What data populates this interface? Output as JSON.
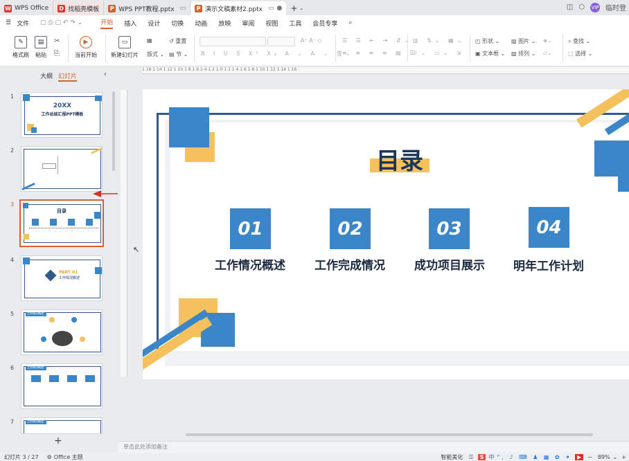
{
  "tabs": [
    {
      "label": "WPS Office",
      "icon": "W",
      "color": "#e0352b"
    },
    {
      "label": "找稻壳模板",
      "icon": "D",
      "color": "#e0352b"
    },
    {
      "label": "WPS PPT教程.pptx",
      "icon": "P",
      "color": "#d4622a"
    },
    {
      "label": "演示文稿素材2.pptx",
      "icon": "P",
      "color": "#d4622a"
    }
  ],
  "user": {
    "name": "临时登",
    "avatar": "VIP"
  },
  "menu": {
    "file": "文件",
    "items": [
      "开始",
      "插入",
      "设计",
      "切换",
      "动画",
      "放映",
      "审阅",
      "视图",
      "工具",
      "会员专享"
    ]
  },
  "ribbon": {
    "format_painter": "格式刷",
    "paste": "粘贴",
    "from_current": "当前开始",
    "new_slide": "新建幻灯片",
    "layout": "版式",
    "section": "节",
    "reset": "重置",
    "shape": "形状",
    "picture": "图片",
    "textbox": "文本框",
    "arrange": "排列",
    "find": "查找",
    "select": "选择"
  },
  "left_pane": {
    "outline": "大纲",
    "slides": "幻灯片",
    "add": "+"
  },
  "thumbs": [
    {
      "num": "1",
      "title": "20XX",
      "subtitle": "工作总结汇报PPT模板"
    },
    {
      "num": "2"
    },
    {
      "num": "3",
      "title": "目录"
    },
    {
      "num": "4",
      "title": "PART 01",
      "subtitle": "工作情况概述",
      "badge": "01"
    },
    {
      "num": "5",
      "title": "工作情况概述"
    },
    {
      "num": "6",
      "title": "工作情况概述"
    },
    {
      "num": "7",
      "title": "工作情况概述"
    }
  ],
  "slide": {
    "title": "目录",
    "items": [
      {
        "num": "01",
        "label": "工作情况概述"
      },
      {
        "num": "02",
        "label": "工作完成情况"
      },
      {
        "num": "03",
        "label": "成功项目展示"
      },
      {
        "num": "04",
        "label": "明年工作计划"
      }
    ],
    "colors": {
      "blue": "#3a86c8",
      "yellow": "#f5c15c",
      "dark": "#1c3557",
      "frame": "#2f5a8a"
    }
  },
  "notes": "单击此处添加备注",
  "status": {
    "slide_count": "幻灯片 3 / 27",
    "theme": "Office 主题",
    "beautify": "智能美化",
    "ime": "中",
    "zoom": "89%"
  },
  "ruler": "1 16 1 14 1 12 1 10 1 8 1 6 1 4 1 2 1 0 1 2 1 4 1 6 1 8 1 10 1 12 1 14 1 16"
}
